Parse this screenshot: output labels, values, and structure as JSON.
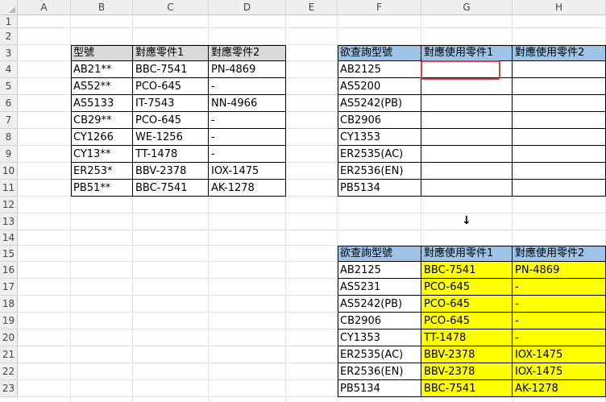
{
  "columns": [
    "A",
    "B",
    "C",
    "D",
    "E",
    "F",
    "G",
    "H"
  ],
  "rows": [
    "1",
    "2",
    "3",
    "4",
    "5",
    "6",
    "7",
    "8",
    "9",
    "10",
    "11",
    "12",
    "13",
    "14",
    "15",
    "16",
    "17",
    "18",
    "19",
    "20",
    "21",
    "22",
    "23"
  ],
  "table1": {
    "headers": [
      "型號",
      "對應零件1",
      "對應零件2"
    ],
    "rows": [
      [
        "AB21**",
        "BBC-7541",
        "PN-4869"
      ],
      [
        "AS52**",
        "PCO-645",
        "-"
      ],
      [
        "AS5133",
        "IT-7543",
        "NN-4966"
      ],
      [
        "CB29**",
        "PCO-645",
        "-"
      ],
      [
        "CY1266",
        "WE-1256",
        "-"
      ],
      [
        "CY13**",
        "TT-1478",
        "-"
      ],
      [
        "ER253*",
        "BBV-2378",
        "IOX-1475"
      ],
      [
        "PB51**",
        "BBC-7541",
        "AK-1278"
      ]
    ]
  },
  "table2": {
    "headers": [
      "欲查詢型號",
      "對應使用零件1",
      "對應使用零件2"
    ],
    "rows": [
      [
        "AB2125",
        "",
        ""
      ],
      [
        "AS5200",
        "",
        ""
      ],
      [
        "AS5242(PB)",
        "",
        ""
      ],
      [
        "CB2906",
        "",
        ""
      ],
      [
        "CY1353",
        "",
        ""
      ],
      [
        "ER2535(AC)",
        "",
        ""
      ],
      [
        "ER2536(EN)",
        "",
        ""
      ],
      [
        "PB5134",
        "",
        ""
      ]
    ]
  },
  "arrow": "↓",
  "table3": {
    "headers": [
      "欲查詢型號",
      "對應使用零件1",
      "對應使用零件2"
    ],
    "rows": [
      [
        "AB2125",
        "BBC-7541",
        "PN-4869"
      ],
      [
        "AS5231",
        "PCO-645",
        "-"
      ],
      [
        "AS5242(PB)",
        "PCO-645",
        "-"
      ],
      [
        "CB2906",
        "PCO-645",
        "-"
      ],
      [
        "CY1353",
        "TT-1478",
        "-"
      ],
      [
        "ER2535(AC)",
        "BBV-2378",
        "IOX-1475"
      ],
      [
        "ER2536(EN)",
        "BBV-2378",
        "IOX-1475"
      ],
      [
        "PB5134",
        "BBC-7541",
        "AK-1278"
      ]
    ]
  },
  "colors": {
    "header_gray": "#d9d9d9",
    "header_blue": "#9dc3e6",
    "highlight": "#ffff00",
    "selection": "#e0403a"
  }
}
